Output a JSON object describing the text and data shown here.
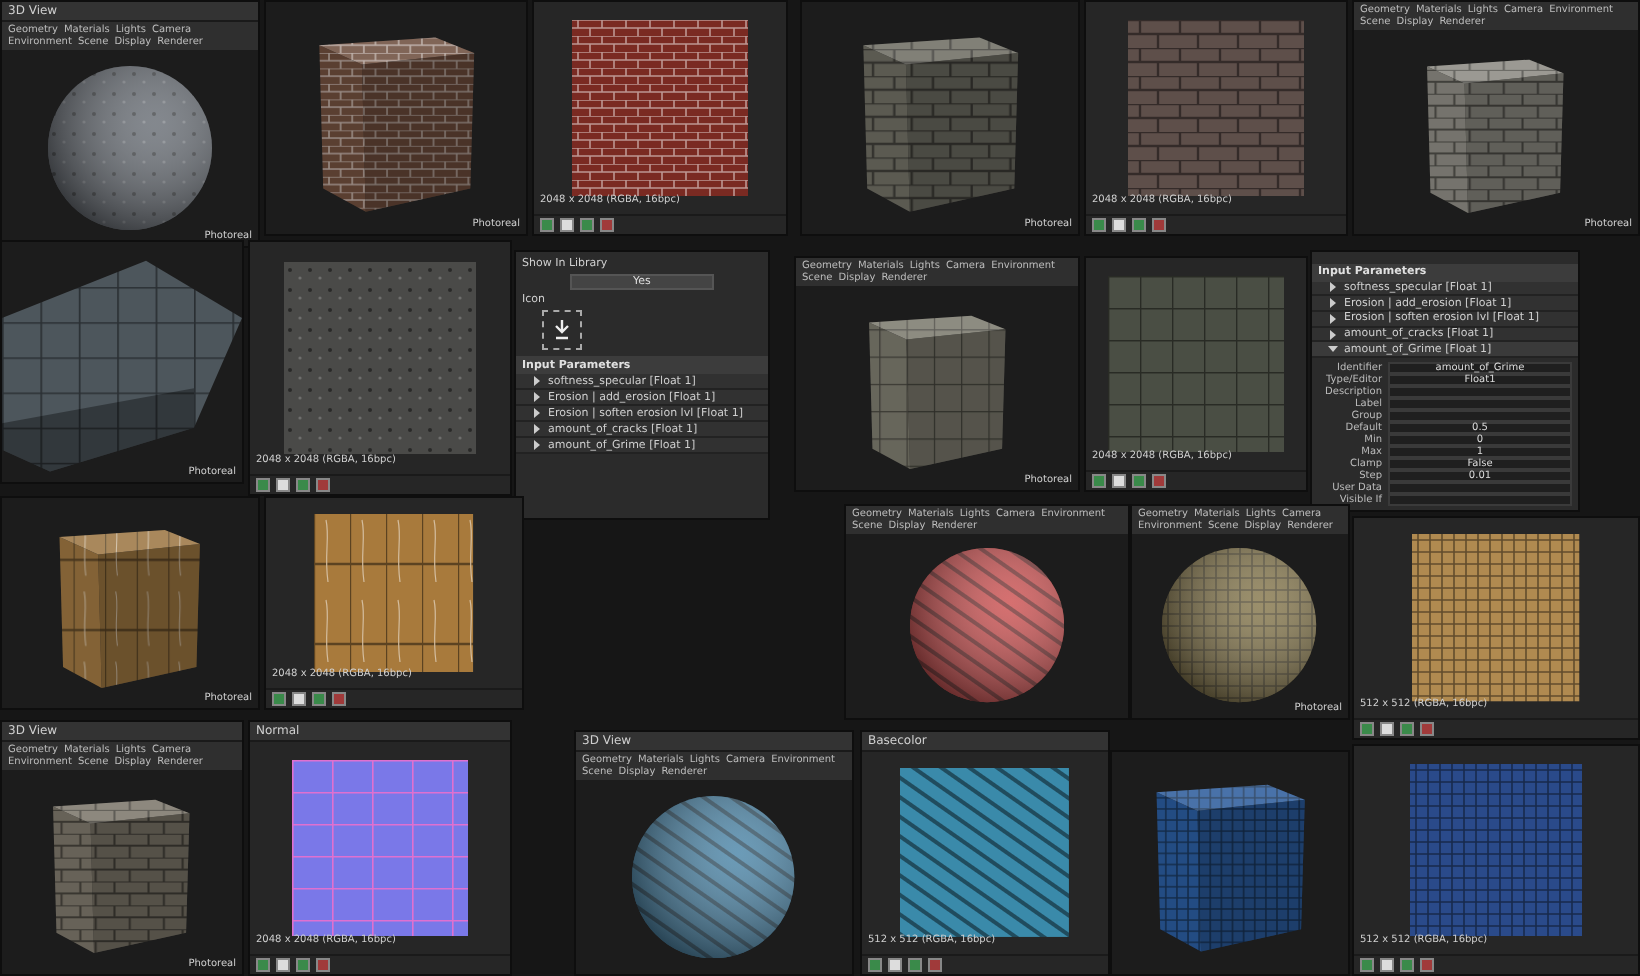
{
  "panels": [
    {
      "kind": "view3d",
      "title": "3D View",
      "menu": [
        "Geometry",
        "Materials",
        "Lights",
        "Camera",
        "Environment",
        "Scene",
        "Display",
        "Renderer"
      ],
      "mode": "Photoreal"
    },
    {
      "kind": "view3d",
      "mode": "Photoreal"
    },
    {
      "kind": "view2d",
      "resolution": "2048 x 2048 (RGBA, 16bpc)"
    },
    {
      "kind": "view3d",
      "mode": "Photoreal"
    },
    {
      "kind": "view2d",
      "resolution": "2048 x 2048 (RGBA, 16bpc)"
    },
    {
      "kind": "view3d",
      "menu": [
        "Geometry",
        "Materials",
        "Lights",
        "Camera",
        "Environment",
        "Scene",
        "Display",
        "Renderer"
      ],
      "mode": "Photoreal"
    },
    {
      "kind": "view3d",
      "mode": "Photoreal"
    },
    {
      "kind": "view2d",
      "resolution": "2048 x 2048 (RGBA, 16bpc)"
    },
    {
      "kind": "params",
      "library_label": "Show In Library",
      "library_value": "Yes",
      "icon_label": "Icon",
      "section": "Input Parameters",
      "items": [
        {
          "name": "softness_specular [Float 1]",
          "expanded": false
        },
        {
          "name": "Erosion | add_erosion [Float 1]",
          "expanded": false
        },
        {
          "name": "Erosion | soften erosion lvl [Float 1]",
          "expanded": false
        },
        {
          "name": "amount_of_cracks [Float 1]",
          "expanded": false
        },
        {
          "name": "amount_of_Grime [Float 1]",
          "expanded": false
        }
      ]
    },
    {
      "kind": "view3d",
      "menu": [
        "Geometry",
        "Materials",
        "Lights",
        "Camera",
        "Environment",
        "Scene",
        "Display",
        "Renderer"
      ],
      "mode": "Photoreal"
    },
    {
      "kind": "view2d",
      "resolution": "2048 x 2048 (RGBA, 16bpc)"
    },
    {
      "kind": "params",
      "section": "Input Parameters",
      "items": [
        {
          "name": "softness_specular [Float 1]",
          "expanded": false
        },
        {
          "name": "Erosion | add_erosion [Float 1]",
          "expanded": false
        },
        {
          "name": "Erosion | soften erosion lvl [Float 1]",
          "expanded": false
        },
        {
          "name": "amount_of_cracks [Float 1]",
          "expanded": false
        },
        {
          "name": "amount_of_Grime [Float 1]",
          "expanded": true
        }
      ],
      "fields": [
        {
          "label": "Identifier",
          "value": "amount_of_Grime"
        },
        {
          "label": "Type/Editor",
          "value": "Float1"
        },
        {
          "label": "Description"
        },
        {
          "label": "Label"
        },
        {
          "label": "Group"
        },
        {
          "label": "Default",
          "value": "0.5"
        },
        {
          "label": "Min",
          "value": "0"
        },
        {
          "label": "Max",
          "value": "1"
        },
        {
          "label": "Clamp",
          "value": "False"
        },
        {
          "label": "Step",
          "value": "0.01"
        },
        {
          "label": "User Data"
        },
        {
          "label": "Visible If"
        }
      ]
    },
    {
      "kind": "view3d",
      "mode": "Photoreal"
    },
    {
      "kind": "view2d",
      "resolution": "2048 x 2048 (RGBA, 16bpc)"
    },
    {
      "kind": "view3d",
      "menu": [
        "Geometry",
        "Materials",
        "Lights",
        "Camera",
        "Environment",
        "Scene",
        "Display",
        "Renderer"
      ]
    },
    {
      "kind": "view3d",
      "menu": [
        "Geometry",
        "Materials",
        "Lights",
        "Camera",
        "Environment",
        "Scene",
        "Display",
        "Renderer"
      ],
      "mode": "Photoreal"
    },
    {
      "kind": "view2d",
      "resolution": "512 x 512 (RGBA, 16bpc)"
    },
    {
      "kind": "view3d",
      "title": "3D View",
      "menu": [
        "Geometry",
        "Materials",
        "Lights",
        "Camera",
        "Environment",
        "Scene",
        "Display",
        "Renderer"
      ],
      "mode": "Photoreal"
    },
    {
      "kind": "view2d",
      "title": "Normal",
      "resolution": "2048 x 2048 (RGBA, 16bpc)"
    },
    {
      "kind": "view3d",
      "title": "3D View",
      "menu": [
        "Geometry",
        "Materials",
        "Lights",
        "Camera",
        "Environment",
        "Scene",
        "Display",
        "Renderer"
      ]
    },
    {
      "kind": "view2d",
      "title": "Basecolor",
      "resolution": "512 x 512 (RGBA, 16bpc)"
    },
    {
      "kind": "view3d"
    },
    {
      "kind": "view2d",
      "resolution": "512 x 512 (RGBA, 16bpc)"
    }
  ]
}
